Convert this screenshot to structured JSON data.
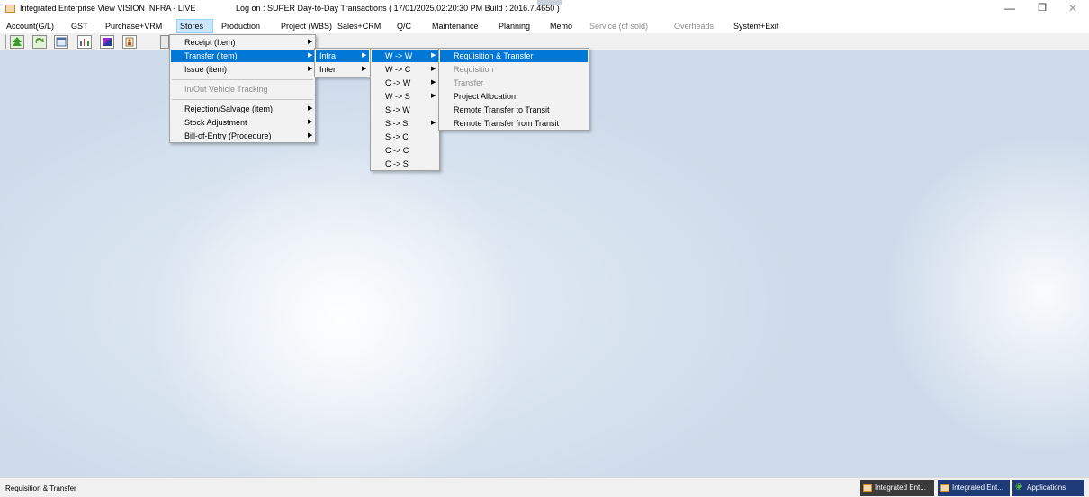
{
  "titlebar": {
    "title": "Integrated Enterprise View  VISION INFRA - LIVE",
    "logon": "Log on : SUPER  Day-to-Day Transactions ( 17/01/2025,02:20:30 PM Build : 2016.7.4650 )",
    "minimize": "—",
    "maximize": "❐",
    "close": "✕"
  },
  "menubar": {
    "items": [
      {
        "label": "Account(G/L)"
      },
      {
        "label": "GST"
      },
      {
        "label": "Purchase+VRM"
      },
      {
        "label": "Stores"
      },
      {
        "label": "Production"
      },
      {
        "label": "Project (WBS)"
      },
      {
        "label": "Sales+CRM"
      },
      {
        "label": "Q/C"
      },
      {
        "label": "Maintenance"
      },
      {
        "label": "Planning"
      },
      {
        "label": "Memo"
      },
      {
        "label": "Service (of sold)"
      },
      {
        "label": "Overheads"
      },
      {
        "label": "System+Exit"
      }
    ],
    "active": "Stores"
  },
  "toolbar": {
    "icons": [
      "tree-icon",
      "refresh-icon",
      "window-icon",
      "chart-icon",
      "color-icon",
      "user-icon"
    ]
  },
  "stores_menu": {
    "items": [
      {
        "label": "Receipt (Item)",
        "arrow": "▶"
      },
      {
        "label": "Transfer (item)",
        "arrow": "▶"
      },
      {
        "label": "Issue (item)",
        "arrow": "▶"
      },
      {
        "label": "In/Out Vehicle Tracking",
        "arrow": ""
      },
      {
        "label": "Rejection/Salvage (item)",
        "arrow": "▶"
      },
      {
        "label": "Stock  Adjustment",
        "arrow": "▶"
      },
      {
        "label": "Bill-of-Entry (Procedure)",
        "arrow": "▶"
      }
    ]
  },
  "transfer_menu": {
    "items": [
      {
        "label": "Intra",
        "arrow": "▶"
      },
      {
        "label": "Inter",
        "arrow": "▶"
      }
    ]
  },
  "intra_menu": {
    "items": [
      {
        "label": "W -> W",
        "arrow": "▶"
      },
      {
        "label": "W -> C",
        "arrow": "▶"
      },
      {
        "label": "C -> W",
        "arrow": "▶"
      },
      {
        "label": "W -> S",
        "arrow": "▶"
      },
      {
        "label": "S -> W",
        "arrow": ""
      },
      {
        "label": "S -> S",
        "arrow": "▶"
      },
      {
        "label": "S -> C",
        "arrow": ""
      },
      {
        "label": "C -> C",
        "arrow": ""
      },
      {
        "label": "C -> S",
        "arrow": ""
      }
    ]
  },
  "ww_menu": {
    "items": [
      {
        "label": "Requisition & Transfer"
      },
      {
        "label": "Requisition"
      },
      {
        "label": "Transfer"
      },
      {
        "label": "Project Allocation"
      },
      {
        "label": "Remote Transfer to Transit"
      },
      {
        "label": "Remote Transfer from Transit"
      }
    ]
  },
  "statusbar": {
    "text": "Requisition & Transfer",
    "tasks": [
      {
        "label": "Integrated Ent..."
      },
      {
        "label": "Integrated Ent..."
      },
      {
        "label": "Applications"
      }
    ]
  }
}
